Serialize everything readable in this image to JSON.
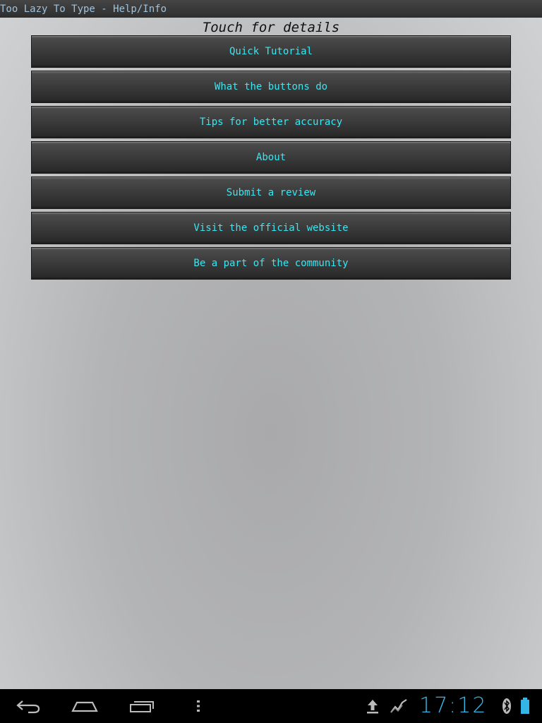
{
  "app": {
    "window_title": "Too Lazy To Type - Help/Info"
  },
  "main": {
    "heading": "Touch for details",
    "buttons": [
      {
        "label": "Quick Tutorial"
      },
      {
        "label": "What the buttons do"
      },
      {
        "label": "Tips for better accuracy"
      },
      {
        "label": "About"
      },
      {
        "label": "Submit a review"
      },
      {
        "label": "Visit the official website"
      },
      {
        "label": "Be a part of the community"
      }
    ]
  },
  "system_bar": {
    "time": "17:12",
    "icons": [
      "back-icon",
      "home-icon",
      "recent-apps-icon",
      "menu-icon",
      "upload-icon",
      "activity-icon",
      "bluetooth-icon",
      "battery-icon"
    ],
    "accent_color": "#33b5e5"
  },
  "colors": {
    "button_text": "#39e6f2",
    "title_text": "#9fc3dd"
  }
}
